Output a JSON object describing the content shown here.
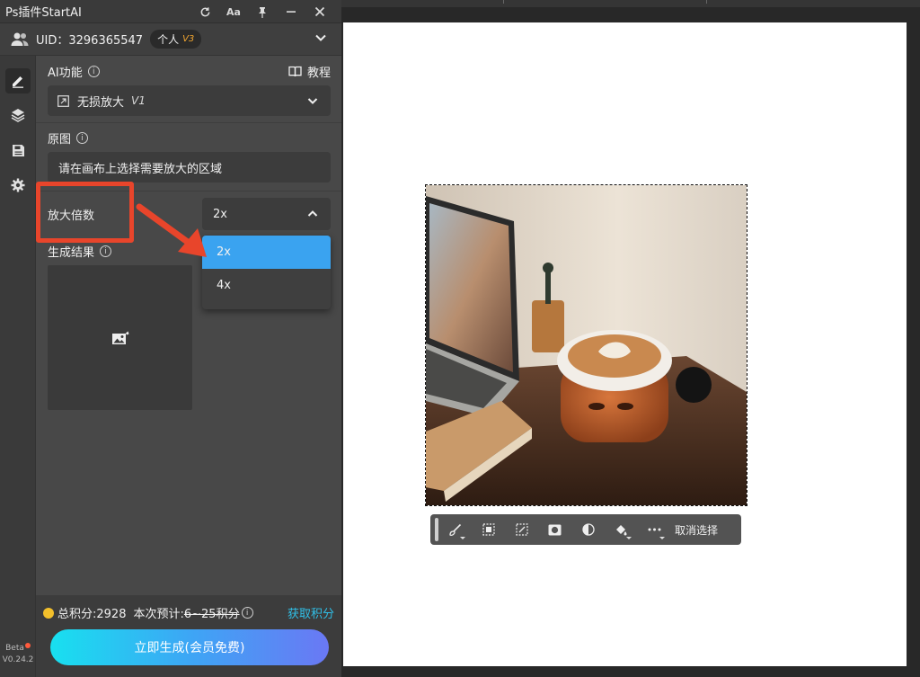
{
  "app": {
    "title": "Ps插件StartAI"
  },
  "user": {
    "uid_label": "UID：3296365547",
    "tier": "个人",
    "tier_version": "V3"
  },
  "ai_function": {
    "label": "AI功能",
    "tutorial": "教程",
    "selected": "无损放大",
    "selected_version": "V1"
  },
  "source": {
    "label": "原图",
    "placeholder": "请在画布上选择需要放大的区域"
  },
  "scale": {
    "label": "放大倍数",
    "value": "2x",
    "options": [
      "2x",
      "4x"
    ]
  },
  "result": {
    "label": "生成结果"
  },
  "footer": {
    "total_points": "总积分:2928",
    "estimate_label": "本次预计:",
    "estimate_range": "6~25积分",
    "get_points": "获取积分",
    "generate_button": "立即生成(会员免费)"
  },
  "version": {
    "beta": "Beta",
    "number": "V0.24.2"
  },
  "canvas_toolbar": {
    "cancel_selection": "取消选择"
  },
  "colors": {
    "accent_blue": "#3aa3f0",
    "annotation_red": "#e8452b",
    "points_link": "#30c0e8"
  }
}
